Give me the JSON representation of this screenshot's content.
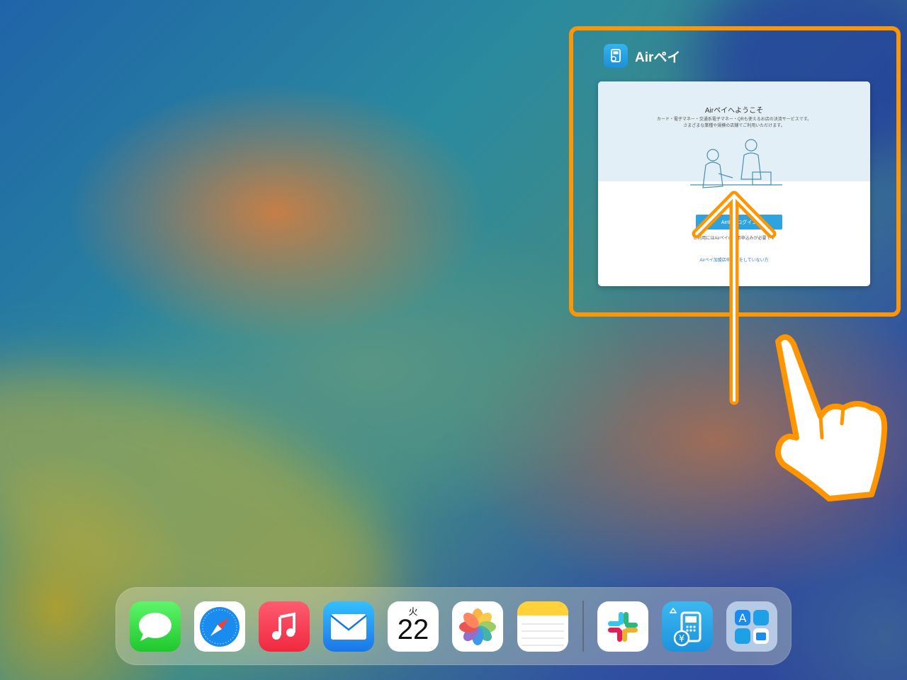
{
  "app_switcher": {
    "app_name": "Airペイ",
    "preview": {
      "welcome_title": "Airペイへようこそ",
      "description_line1": "カード・電子マネー・交通系電子マネー・QRも使えるお店の決済サービスです。",
      "description_line2": "さまざまな業種や規模の店舗でご利用いただけます。",
      "login_button": "AirIDでログイン",
      "note": "ご利用にはAirペイの利用申込みが必要です",
      "signup_link": "Airペイ加盟店申込みをしていない方"
    }
  },
  "dock": {
    "apps": [
      "messages-app",
      "safari-app",
      "music-app",
      "mail-app",
      "calendar-app",
      "photos-app",
      "notes-app",
      "slack-app",
      "airpay-app",
      "app-library"
    ],
    "calendar_day": "火",
    "calendar_date": "22"
  },
  "colors": {
    "annotation": "#ff9500",
    "airpay_blue": "#2fa3e0"
  }
}
